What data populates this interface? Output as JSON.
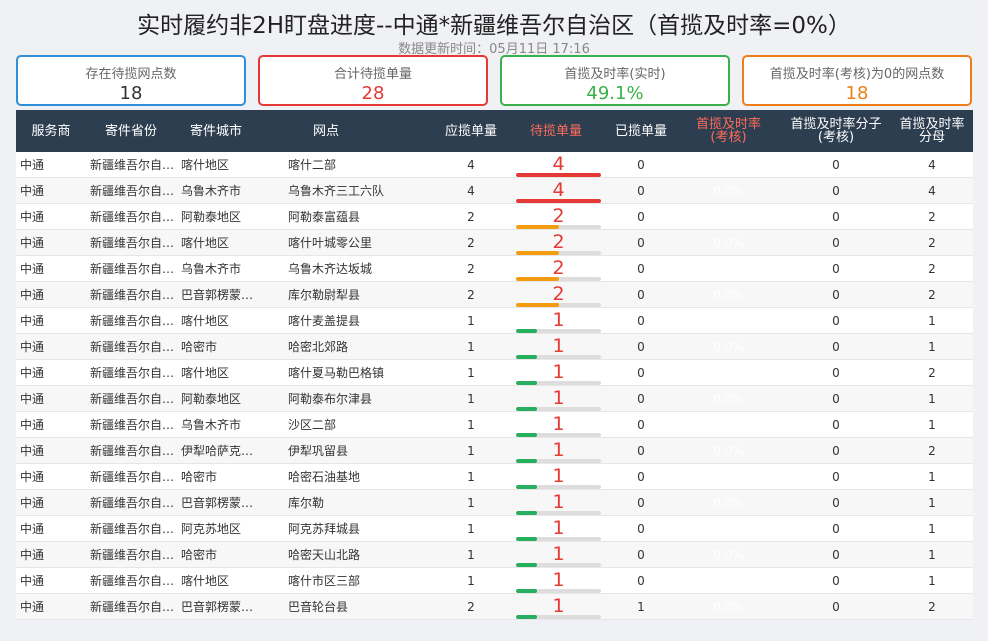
{
  "header": {
    "title": "实时履约非2H盯盘进度--中通*新疆维吾尔自治区（首揽及时率=0%）",
    "subtitle": "数据更新时间：05月11日 17:16"
  },
  "cards": [
    {
      "label": "存在待揽网点数",
      "value": "18",
      "color": "#2f8fd8"
    },
    {
      "label": "合计待揽单量",
      "value": "28",
      "color": "#e53935"
    },
    {
      "label": "首揽及时率(实时)",
      "value": "49.1%",
      "color": "#3bb04a"
    },
    {
      "label": "首揽及时率(考核)为0的网点数",
      "value": "18",
      "color": "#ef7e1a"
    }
  ],
  "table": {
    "headers": [
      "服务商",
      "寄件省份",
      "寄件城市",
      "网点",
      "应揽单量",
      "待揽单量",
      "已揽单量",
      "首揽及时率\n(考核)",
      "首揽及时率分子\n(考核)",
      "首揽及时率\n分母"
    ],
    "bar_colors": {
      "high": "#e53935",
      "mid": "#f39c12",
      "low": "#27ae60"
    },
    "rows": [
      {
        "carrier": "中通",
        "province": "新疆维吾尔自…",
        "city": "喀什地区",
        "site": "喀什二部",
        "should": "4",
        "pending": "4",
        "pending_frac": 1.0,
        "level": "high",
        "picked": "0",
        "rate": "0.0%",
        "numer": "0",
        "denom": "4"
      },
      {
        "carrier": "中通",
        "province": "新疆维吾尔自…",
        "city": "乌鲁木齐市",
        "site": "乌鲁木齐三工六队",
        "should": "4",
        "pending": "4",
        "pending_frac": 1.0,
        "level": "high",
        "picked": "0",
        "rate": "0.0%",
        "numer": "0",
        "denom": "4"
      },
      {
        "carrier": "中通",
        "province": "新疆维吾尔自…",
        "city": "阿勒泰地区",
        "site": "阿勒泰富蕴县",
        "should": "2",
        "pending": "2",
        "pending_frac": 0.5,
        "level": "mid",
        "picked": "0",
        "rate": "0.0%",
        "numer": "0",
        "denom": "2"
      },
      {
        "carrier": "中通",
        "province": "新疆维吾尔自…",
        "city": "喀什地区",
        "site": "喀什叶城零公里",
        "should": "2",
        "pending": "2",
        "pending_frac": 0.5,
        "level": "mid",
        "picked": "0",
        "rate": "0.0%",
        "numer": "0",
        "denom": "2"
      },
      {
        "carrier": "中通",
        "province": "新疆维吾尔自…",
        "city": "乌鲁木齐市",
        "site": "乌鲁木齐达坂城",
        "should": "2",
        "pending": "2",
        "pending_frac": 0.5,
        "level": "mid",
        "picked": "0",
        "rate": "0.0%",
        "numer": "0",
        "denom": "2"
      },
      {
        "carrier": "中通",
        "province": "新疆维吾尔自…",
        "city": "巴音郭楞蒙…",
        "site": "库尔勒尉犁县",
        "should": "2",
        "pending": "2",
        "pending_frac": 0.5,
        "level": "mid",
        "picked": "0",
        "rate": "0.0%",
        "numer": "0",
        "denom": "2"
      },
      {
        "carrier": "中通",
        "province": "新疆维吾尔自…",
        "city": "喀什地区",
        "site": "喀什麦盖提县",
        "should": "1",
        "pending": "1",
        "pending_frac": 0.25,
        "level": "low",
        "picked": "0",
        "rate": "0.0%",
        "numer": "0",
        "denom": "1"
      },
      {
        "carrier": "中通",
        "province": "新疆维吾尔自…",
        "city": "哈密市",
        "site": "哈密北郊路",
        "should": "1",
        "pending": "1",
        "pending_frac": 0.25,
        "level": "low",
        "picked": "0",
        "rate": "0.0%",
        "numer": "0",
        "denom": "1"
      },
      {
        "carrier": "中通",
        "province": "新疆维吾尔自…",
        "city": "喀什地区",
        "site": "喀什夏马勒巴格镇",
        "should": "1",
        "pending": "1",
        "pending_frac": 0.25,
        "level": "low",
        "picked": "0",
        "rate": "0.0%",
        "numer": "0",
        "denom": "2"
      },
      {
        "carrier": "中通",
        "province": "新疆维吾尔自…",
        "city": "阿勒泰地区",
        "site": "阿勒泰布尔津县",
        "should": "1",
        "pending": "1",
        "pending_frac": 0.25,
        "level": "low",
        "picked": "0",
        "rate": "0.0%",
        "numer": "0",
        "denom": "1"
      },
      {
        "carrier": "中通",
        "province": "新疆维吾尔自…",
        "city": "乌鲁木齐市",
        "site": "沙区二部",
        "should": "1",
        "pending": "1",
        "pending_frac": 0.25,
        "level": "low",
        "picked": "0",
        "rate": "0.0%",
        "numer": "0",
        "denom": "1"
      },
      {
        "carrier": "中通",
        "province": "新疆维吾尔自…",
        "city": "伊犁哈萨克…",
        "site": "伊犁巩留县",
        "should": "1",
        "pending": "1",
        "pending_frac": 0.25,
        "level": "low",
        "picked": "0",
        "rate": "0.0%",
        "numer": "0",
        "denom": "2"
      },
      {
        "carrier": "中通",
        "province": "新疆维吾尔自…",
        "city": "哈密市",
        "site": "哈密石油基地",
        "should": "1",
        "pending": "1",
        "pending_frac": 0.25,
        "level": "low",
        "picked": "0",
        "rate": "0.0%",
        "numer": "0",
        "denom": "1"
      },
      {
        "carrier": "中通",
        "province": "新疆维吾尔自…",
        "city": "巴音郭楞蒙…",
        "site": "库尔勒",
        "should": "1",
        "pending": "1",
        "pending_frac": 0.25,
        "level": "low",
        "picked": "0",
        "rate": "0.0%",
        "numer": "0",
        "denom": "1"
      },
      {
        "carrier": "中通",
        "province": "新疆维吾尔自…",
        "city": "阿克苏地区",
        "site": "阿克苏拜城县",
        "should": "1",
        "pending": "1",
        "pending_frac": 0.25,
        "level": "low",
        "picked": "0",
        "rate": "0.0%",
        "numer": "0",
        "denom": "1"
      },
      {
        "carrier": "中通",
        "province": "新疆维吾尔自…",
        "city": "哈密市",
        "site": "哈密天山北路",
        "should": "1",
        "pending": "1",
        "pending_frac": 0.25,
        "level": "low",
        "picked": "0",
        "rate": "0.0%",
        "numer": "0",
        "denom": "1"
      },
      {
        "carrier": "中通",
        "province": "新疆维吾尔自…",
        "city": "喀什地区",
        "site": "喀什市区三部",
        "should": "1",
        "pending": "1",
        "pending_frac": 0.25,
        "level": "low",
        "picked": "0",
        "rate": "0.0%",
        "numer": "0",
        "denom": "1"
      },
      {
        "carrier": "中通",
        "province": "新疆维吾尔自…",
        "city": "巴音郭楞蒙…",
        "site": "巴音轮台县",
        "should": "2",
        "pending": "1",
        "pending_frac": 0.25,
        "level": "low",
        "picked": "1",
        "rate": "0.0%",
        "numer": "0",
        "denom": "2"
      }
    ]
  }
}
